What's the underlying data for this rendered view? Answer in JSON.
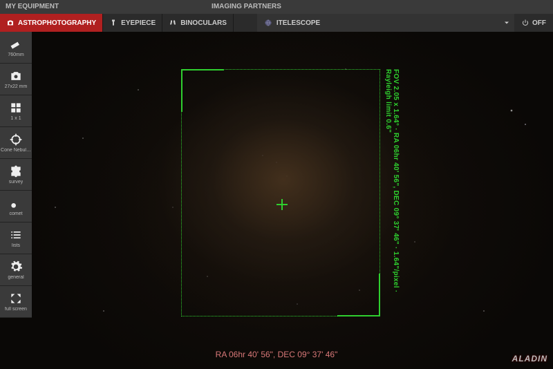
{
  "topbar": {
    "equipment_label": "MY EQUIPMENT",
    "partners_label": "IMAGING PARTNERS"
  },
  "tabs": {
    "astro": "ASTROPHOTOGRAPHY",
    "eyepiece": "EYEPIECE",
    "binoculars": "BINOCULARS"
  },
  "partner": {
    "selected": "ITELESCOPE",
    "off_label": "OFF"
  },
  "sidebar": [
    {
      "key": "telescope",
      "label": "760mm"
    },
    {
      "key": "camera",
      "label": "27x22 mm"
    },
    {
      "key": "mosaic",
      "label": "1 x 1"
    },
    {
      "key": "target",
      "label": "Cone Nebul…"
    },
    {
      "key": "survey",
      "label": "survey"
    },
    {
      "key": "comet",
      "label": "comet"
    },
    {
      "key": "lists",
      "label": "lists"
    },
    {
      "key": "general",
      "label": "general"
    },
    {
      "key": "fullscreen",
      "label": "full screen"
    }
  ],
  "fov": {
    "annotation": "FOV 2.05 x 1.64° · RA 06hr 40' 56\", DEC 09° 37' 46\" · 1.64\"/pixel · Rayleigh limit 0.6\""
  },
  "footer": {
    "coords": "RA 06hr 40' 56\", DEC 09° 37' 46\"",
    "logo": "ALADIN"
  },
  "colors": {
    "accent_red": "#b02020",
    "fov_green": "#2fd02f",
    "coord_pink": "#d87878"
  }
}
